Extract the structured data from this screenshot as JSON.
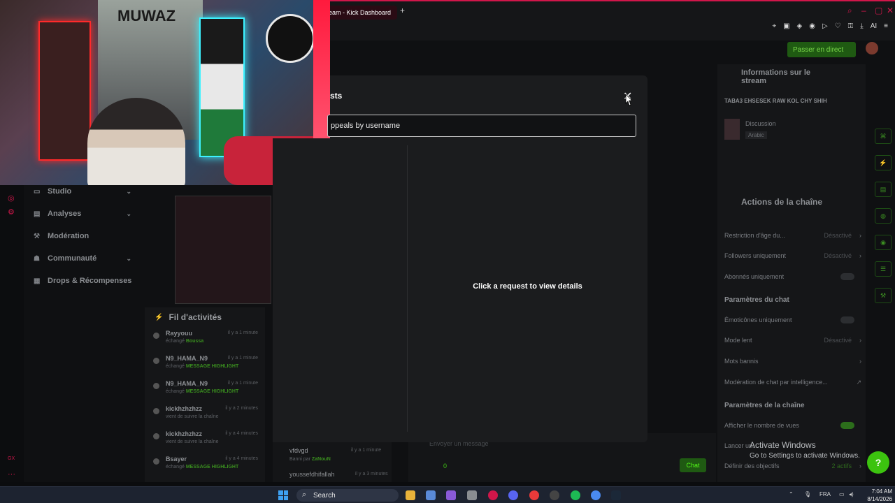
{
  "browser": {
    "tab_title": "eam - Kick Dashboard",
    "new_tab_label": "+",
    "toolbar_ai_label": "AI"
  },
  "header": {
    "go_live_label": "Passer en direct"
  },
  "sidebar": {
    "items": [
      {
        "label": "Studio",
        "icon": "studio-icon"
      },
      {
        "label": "Analyses",
        "icon": "chart-icon"
      },
      {
        "label": "Modération",
        "icon": "hammer-icon"
      },
      {
        "label": "Communauté",
        "icon": "community-icon"
      },
      {
        "label": "Drops & Récompenses",
        "icon": "gift-icon"
      }
    ]
  },
  "activity": {
    "title": "Fil d'activités",
    "rows": [
      {
        "name": "Rayyouu",
        "time": "il y a 1 minute",
        "desc": "échangé",
        "highlight": "Boussa"
      },
      {
        "name": "N9_HAMA_N9",
        "time": "il y a 1 minute",
        "desc": "échangé",
        "highlight": "MESSAGE HIGHLIGHT"
      },
      {
        "name": "N9_HAMA_N9",
        "time": "il y a 1 minute",
        "desc": "échangé",
        "highlight": "MESSAGE HIGHLIGHT"
      },
      {
        "name": "kickhzhzhzz",
        "time": "il y a 2 minutes",
        "desc": "vient de suivre la chaîne",
        "highlight": ""
      },
      {
        "name": "kickhzhzhzz",
        "time": "il y a 4 minutes",
        "desc": "vient de suivre la chaîne",
        "highlight": ""
      },
      {
        "name": "Bsayer",
        "time": "il y a 4 minutes",
        "desc": "échangé",
        "highlight": "MESSAGE HIGHLIGHT"
      }
    ]
  },
  "moderation_feed": {
    "user": "vfdvgd",
    "time": "il y a 1 minute",
    "desc": "Banni par",
    "by": "ZaNouN",
    "user2": "youssefdhifallah",
    "time2": "il y a 3 minutes"
  },
  "chat": {
    "input_placeholder": "Envoyer un message",
    "count": "0",
    "send_label": "Chat"
  },
  "stream_info": {
    "title": "Informations sur le stream",
    "stream_title": "TABA3 EHSESEK RAW KOL CHY SHIH",
    "category": "Discussion",
    "language": "Arabic"
  },
  "channel_actions": {
    "title": "Actions de la chaîne",
    "rows": [
      {
        "label": "Restriction d'âge du...",
        "value": "Désactivé"
      },
      {
        "label": "Followers uniquement",
        "value": "Désactivé"
      },
      {
        "label": "Abonnés uniquement",
        "value": ""
      }
    ],
    "chat_settings_title": "Paramètres du chat",
    "chat_rows": [
      {
        "label": "Émoticônes uniquement",
        "value": ""
      },
      {
        "label": "Mode lent",
        "value": "Désactivé"
      },
      {
        "label": "Mots bannis",
        "value": ""
      },
      {
        "label": "Modération de chat par intelligence...",
        "value": ""
      }
    ],
    "channel_settings_title": "Paramètres de la chaîne",
    "channel_rows": [
      {
        "label": "Afficher le nombre de vues",
        "value": ""
      },
      {
        "label": "Lancer un...",
        "value": ""
      },
      {
        "label": "Définir des objectifs",
        "value": "2 actifs"
      }
    ]
  },
  "modal": {
    "title": "sts",
    "search_placeholder": "ppeals by username",
    "empty_state": "Click a request to view details",
    "close_label": "✕"
  },
  "windows_notice": {
    "line1": "Activate Windows",
    "line2": "Go to Settings to activate Windows."
  },
  "taskbar": {
    "search_label": "Search",
    "language": "FRA",
    "time": "7:04 AM",
    "date": "8/14/2026"
  },
  "webcam": {
    "mural_text": "MUWAZ"
  },
  "colors": {
    "accent": "#53fc18",
    "brand_red": "#d0164a",
    "modal_bg": "#1b1c1e"
  }
}
